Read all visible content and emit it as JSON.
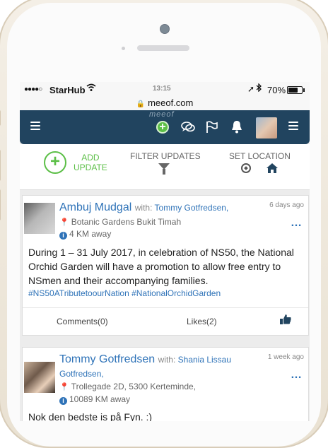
{
  "status_bar": {
    "signal": "●●●●○",
    "carrier": "StarHub",
    "time": "13:15",
    "battery": "70%",
    "battery_level": 0.7
  },
  "browser": {
    "url": "meeof.com"
  },
  "nav": {
    "brand": "meeof",
    "icons": [
      "menu-icon",
      "add-icon",
      "chat-icon",
      "flag-icon",
      "bell-icon",
      "avatar",
      "menu-icon"
    ]
  },
  "actions": {
    "add_update_line1": "ADD",
    "add_update_line2": "UPDATE",
    "filter_updates": "FILTER UPDATES",
    "set_location": "SET LOCATION"
  },
  "posts": [
    {
      "author": "Ambuj Mudgal",
      "with_label": "with:",
      "with_name": "Tommy Gotfredsen,",
      "time": "6 days ago",
      "place": "Botanic Gardens Bukit Timah",
      "distance": "4 KM away",
      "body": "During 1 – 31 July 2017, in celebration of NS50, the National Orchid Garden will have a promotion to allow free entry to NSmen and their accompanying families.",
      "tags": "#NS50ATributetoourNation #NationalOrchidGarden",
      "comments": "Comments(0)",
      "likes": "Likes(2)"
    },
    {
      "author": "Tommy Gotfredsen",
      "with_label": "with:",
      "with_name": "Shania Lissau",
      "with_name_cont": "Gotfredsen,",
      "time": "1 week ago",
      "place": "Trollegade 2D, 5300 Kerteminde,",
      "distance": "10089 KM away",
      "body": "Nok den bedste is på Fyn. :)"
    }
  ]
}
